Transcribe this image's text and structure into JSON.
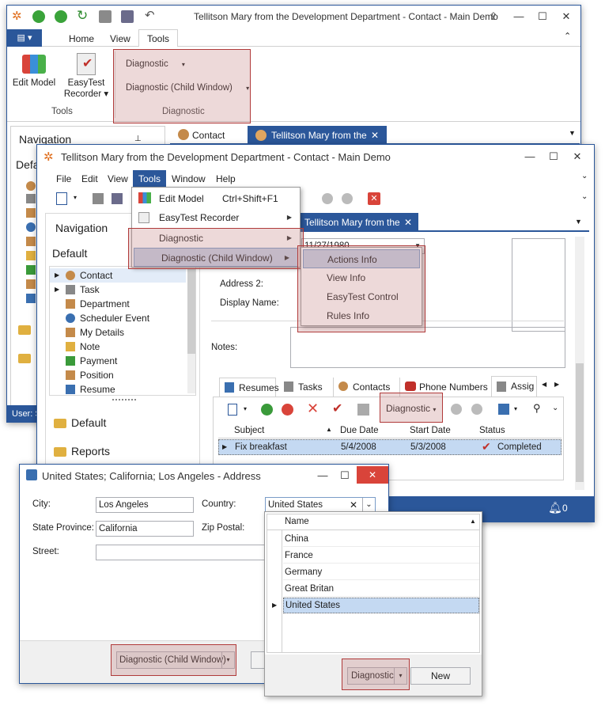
{
  "main_window": {
    "title": "Tellitson Mary from the Development Department - Contact - Main Demo",
    "ribbon_tabs": [
      "Home",
      "View",
      "Tools"
    ],
    "active_tab": "Tools",
    "tools_group": {
      "edit_model": "Edit Model",
      "easytest_recorder_1": "EasyTest",
      "easytest_recorder_2": "Recorder",
      "group_label": "Tools"
    },
    "diagnostic_group": {
      "diagnostic": "Diagnostic",
      "diagnostic_child": "Diagnostic (Child Window)",
      "group_label": "Diagnostic"
    },
    "nav_title": "Navigation",
    "nav_default": "Defa",
    "doc_tabs": [
      "Contact",
      "Tellitson Mary from the"
    ],
    "status_user": "User: S"
  },
  "child_window": {
    "title": "Tellitson Mary from the Development Department - Contact - Main Demo",
    "menu": [
      "File",
      "Edit",
      "View",
      "Tools",
      "Window",
      "Help"
    ],
    "nav_title": "Navigation",
    "nav_default": "Default",
    "tree_items": [
      "Contact",
      "Task",
      "Department",
      "Scheduler Event",
      "My Details",
      "Note",
      "Payment",
      "Position",
      "Resume"
    ],
    "nav_groups": [
      "Default",
      "Reports"
    ],
    "doc_tab": "Tellitson Mary from the",
    "birthday_value": "11/27/1980",
    "labels": {
      "address2": "Address 2:",
      "display_name": "Display Name:",
      "notes": "Notes:"
    },
    "detail_tabs": [
      "Resumes",
      "Tasks",
      "Contacts",
      "Phone Numbers",
      "Assig"
    ],
    "grid_diagnostic": "Diagnostic",
    "grid_headers": [
      "Subject",
      "Due Date",
      "Start Date",
      "Status"
    ],
    "grid_row": {
      "subject": "Fix breakfast",
      "due": "5/4/2008",
      "start": "5/3/2008",
      "status": "Completed"
    },
    "bell_count": "0"
  },
  "tools_menu": {
    "items": [
      {
        "label": "Edit Model",
        "shortcut": "Ctrl+Shift+F1"
      },
      {
        "label": "EasyTest Recorder",
        "shortcut": ""
      },
      {
        "label": "Diagnostic",
        "shortcut": ""
      },
      {
        "label": "Diagnostic (Child Window)",
        "shortcut": ""
      }
    ]
  },
  "submenu": {
    "items": [
      "Actions Info",
      "View Info",
      "EasyTest Control",
      "Rules Info"
    ]
  },
  "address_window": {
    "title": "United States; California; Los Angeles - Address",
    "labels": {
      "city": "City:",
      "country": "Country:",
      "state": "State Province:",
      "zip": "Zip Postal:",
      "street": "Street:"
    },
    "city": "Los Angeles",
    "country": "United States",
    "state": "California",
    "diagnostic_child": "Diagnostic (Child Window)"
  },
  "lookup": {
    "header": "Name",
    "items": [
      "China",
      "France",
      "Germany",
      "Great Britan",
      "United States"
    ],
    "selected": "United States",
    "diagnostic": "Diagnostic",
    "new_button": "New"
  },
  "colors": {
    "accent": "#2b579a",
    "highlight": "#c4d9f2",
    "redframe": "#b03a3a"
  }
}
